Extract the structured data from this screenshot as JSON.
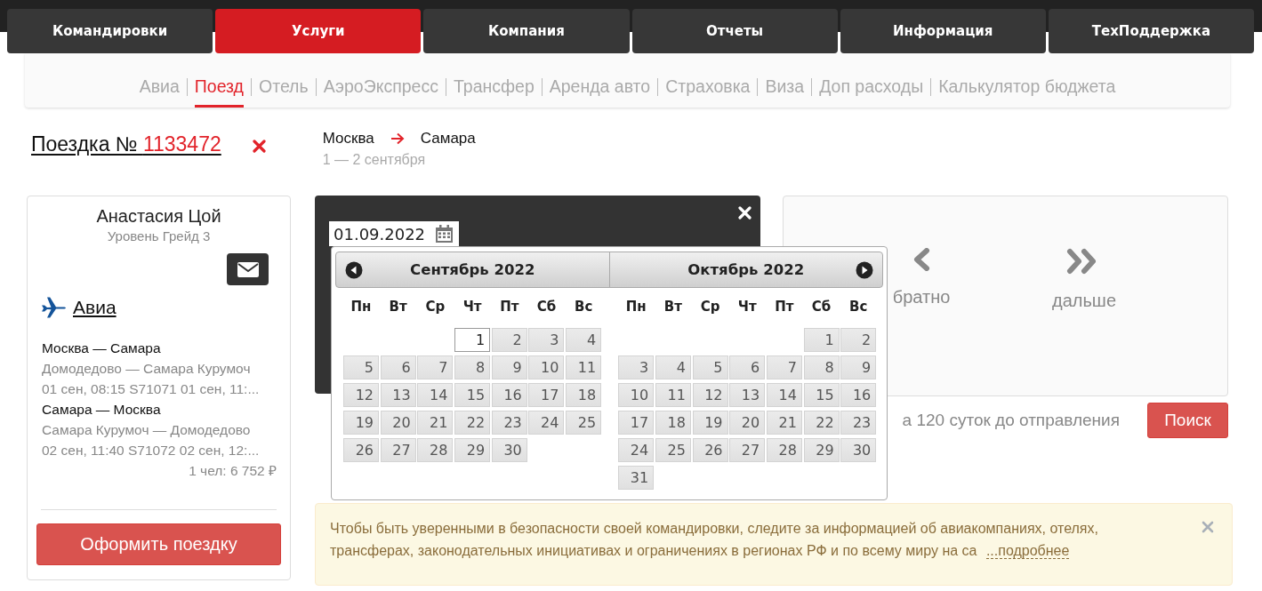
{
  "top_tabs": [
    {
      "label": "Командировки",
      "selected": false
    },
    {
      "label": "Услуги",
      "selected": true
    },
    {
      "label": "Компания",
      "selected": false
    },
    {
      "label": "Отчеты",
      "selected": false
    },
    {
      "label": "Информация",
      "selected": false
    },
    {
      "label": "ТехПоддержка",
      "selected": false
    }
  ],
  "sub_nav": [
    {
      "label": "Авиа",
      "selected": false
    },
    {
      "label": "Поезд",
      "selected": true
    },
    {
      "label": "Отель",
      "selected": false
    },
    {
      "label": "АэроЭкспресс",
      "selected": false
    },
    {
      "label": "Трансфер",
      "selected": false
    },
    {
      "label": "Аренда авто",
      "selected": false
    },
    {
      "label": "Страховка",
      "selected": false
    },
    {
      "label": "Виза",
      "selected": false
    },
    {
      "label": "Доп расходы",
      "selected": false
    },
    {
      "label": "Калькулятор бюджета",
      "selected": false
    }
  ],
  "trip": {
    "label": "Поездка №",
    "number": "1133472"
  },
  "route": {
    "from": "Москва",
    "to": "Самара",
    "dates": "1 — 2 сентября"
  },
  "traveler": {
    "name": "Анастасия Цой",
    "level": "Уровень Грейд 3"
  },
  "booking": {
    "section": "Авиа",
    "segments": [
      {
        "route": "Москва — Самара",
        "airports": "Домодедово — Самара Курумоч",
        "times": "01 сен, 08:15 S71071 01 сен, 11:..."
      },
      {
        "route": "Самара — Москва",
        "airports": "Самара Курумоч — Домодедово",
        "times": "02 сен, 11:40 S71072 02 сен, 12:..."
      }
    ],
    "total": "1 чел: 6 752 ₽",
    "checkout_button": "Оформить поездку"
  },
  "search_form": {
    "date_value": "01.09.2022"
  },
  "datepicker": {
    "months": [
      {
        "title": "Сентябрь 2022",
        "weekdays": [
          "Пн",
          "Вт",
          "Ср",
          "Чт",
          "Пт",
          "Сб",
          "Вс"
        ],
        "weeks": [
          [
            {
              "day": "1",
              "selected": true
            },
            {
              "day": "2",
              "selected": false
            },
            {
              "day": "3",
              "selected": false
            },
            {
              "day": "4",
              "selected": false
            }
          ],
          [
            {
              "day": "5",
              "selected": false
            },
            {
              "day": "6",
              "selected": false
            },
            {
              "day": "7",
              "selected": false
            },
            {
              "day": "8",
              "selected": false
            },
            {
              "day": "9",
              "selected": false
            },
            {
              "day": "10",
              "selected": false
            },
            {
              "day": "11",
              "selected": false
            }
          ],
          [
            {
              "day": "12",
              "selected": false
            },
            {
              "day": "13",
              "selected": false
            },
            {
              "day": "14",
              "selected": false
            },
            {
              "day": "15",
              "selected": false
            },
            {
              "day": "16",
              "selected": false
            },
            {
              "day": "17",
              "selected": false
            },
            {
              "day": "18",
              "selected": false
            }
          ],
          [
            {
              "day": "19",
              "selected": false
            },
            {
              "day": "20",
              "selected": false
            },
            {
              "day": "21",
              "selected": false
            },
            {
              "day": "22",
              "selected": false
            },
            {
              "day": "23",
              "selected": false
            },
            {
              "day": "24",
              "selected": false
            },
            {
              "day": "25",
              "selected": false
            }
          ],
          [
            {
              "day": "26",
              "selected": false
            },
            {
              "day": "27",
              "selected": false
            },
            {
              "day": "28",
              "selected": false
            },
            {
              "day": "29",
              "selected": false
            },
            {
              "day": "30",
              "selected": false
            }
          ]
        ]
      },
      {
        "title": "Октябрь 2022",
        "weekdays": [
          "Пн",
          "Вт",
          "Ср",
          "Чт",
          "Пт",
          "Сб",
          "Вс"
        ],
        "weeks": [
          [
            {
              "day": "1",
              "selected": false
            },
            {
              "day": "2",
              "selected": false
            }
          ],
          [
            {
              "day": "3",
              "selected": false
            },
            {
              "day": "4",
              "selected": false
            },
            {
              "day": "5",
              "selected": false
            },
            {
              "day": "6",
              "selected": false
            },
            {
              "day": "7",
              "selected": false
            },
            {
              "day": "8",
              "selected": false
            },
            {
              "day": "9",
              "selected": false
            }
          ],
          [
            {
              "day": "10",
              "selected": false
            },
            {
              "day": "11",
              "selected": false
            },
            {
              "day": "12",
              "selected": false
            },
            {
              "day": "13",
              "selected": false
            },
            {
              "day": "14",
              "selected": false
            },
            {
              "day": "15",
              "selected": false
            },
            {
              "day": "16",
              "selected": false
            }
          ],
          [
            {
              "day": "17",
              "selected": false
            },
            {
              "day": "18",
              "selected": false
            },
            {
              "day": "19",
              "selected": false
            },
            {
              "day": "20",
              "selected": false
            },
            {
              "day": "21",
              "selected": false
            },
            {
              "day": "22",
              "selected": false
            },
            {
              "day": "23",
              "selected": false
            }
          ],
          [
            {
              "day": "24",
              "selected": false
            },
            {
              "day": "25",
              "selected": false
            },
            {
              "day": "26",
              "selected": false
            },
            {
              "day": "27",
              "selected": false
            },
            {
              "day": "28",
              "selected": false
            },
            {
              "day": "29",
              "selected": false
            },
            {
              "day": "30",
              "selected": false
            }
          ],
          [
            {
              "day": "31",
              "selected": false
            }
          ]
        ]
      }
    ]
  },
  "results": {
    "back_label": "братно",
    "forward_label": "дальше",
    "hint": "а 120 суток до отправления",
    "search_button": "Поиск"
  },
  "notice": {
    "text": "Чтобы быть уверенными в безопасности своей командировки, следите за информацией об авиакомпаниях, отелях, трансферах, законодательных инициативах и ограничениях в регионах РФ и по всему миру на са",
    "link": "...подробнее"
  }
}
